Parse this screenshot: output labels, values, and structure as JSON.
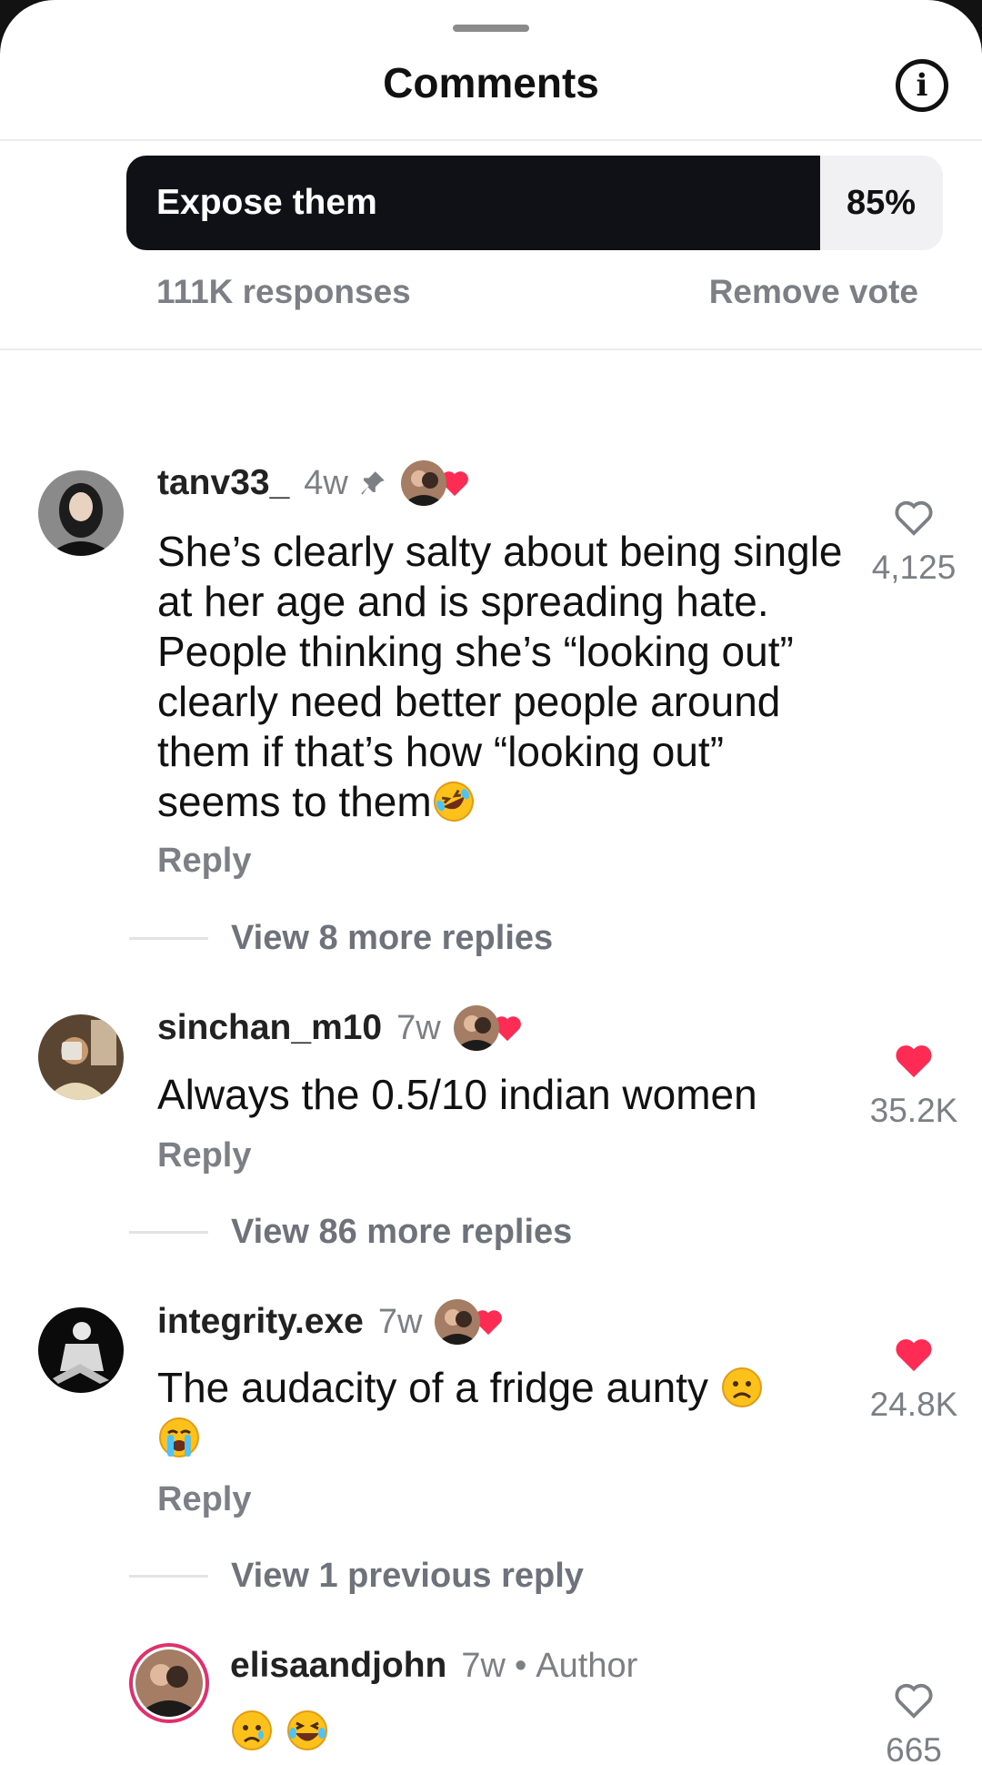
{
  "header": {
    "title": "Comments",
    "info_icon": "info-icon"
  },
  "poll": {
    "option_label": "Expose them",
    "percent_text": "85%",
    "percent_value": 0.85,
    "responses": "111K responses",
    "remove_vote": "Remove vote"
  },
  "colors": {
    "poll_fill": "#101117",
    "heart_red": "#fe2c55",
    "muted": "#7c7f86"
  },
  "comments": [
    {
      "username": "tanv33_",
      "time": "4w",
      "pinned": true,
      "creator_liked": true,
      "text": "She’s clearly salty about being single at her age and is spreading hate. People thinking she’s “looking out” clearly need better people around them if that’s how “looking out” seems to them",
      "trailing_emoji": "rolling-on-floor-laughing-emoji",
      "reply": "Reply",
      "likes": "4,125",
      "liked": false,
      "view_replies": "View 8 more replies"
    },
    {
      "username": "sinchan_m10",
      "time": "7w",
      "creator_liked": true,
      "text": "Always the 0.5/10 indian women",
      "reply": "Reply",
      "likes": "35.2K",
      "liked": true,
      "view_replies": "View 86 more replies"
    },
    {
      "username": "integrity.exe",
      "time": "7w",
      "creator_liked": true,
      "text": "The audacity of a fridge aunty",
      "trailing_emoji": "frowning-face-emoji loudly-crying-face-emoji",
      "reply": "Reply",
      "likes": "24.8K",
      "liked": true,
      "view_replies": "View 1 previous reply"
    },
    {
      "username": "elisaandjohn",
      "time": "7w",
      "author_separator": "•",
      "author_label": "Author",
      "emojis": "crying-face-emoji grinning-squinting-sweat-face-emoji",
      "likes": "665",
      "liked": false
    }
  ]
}
